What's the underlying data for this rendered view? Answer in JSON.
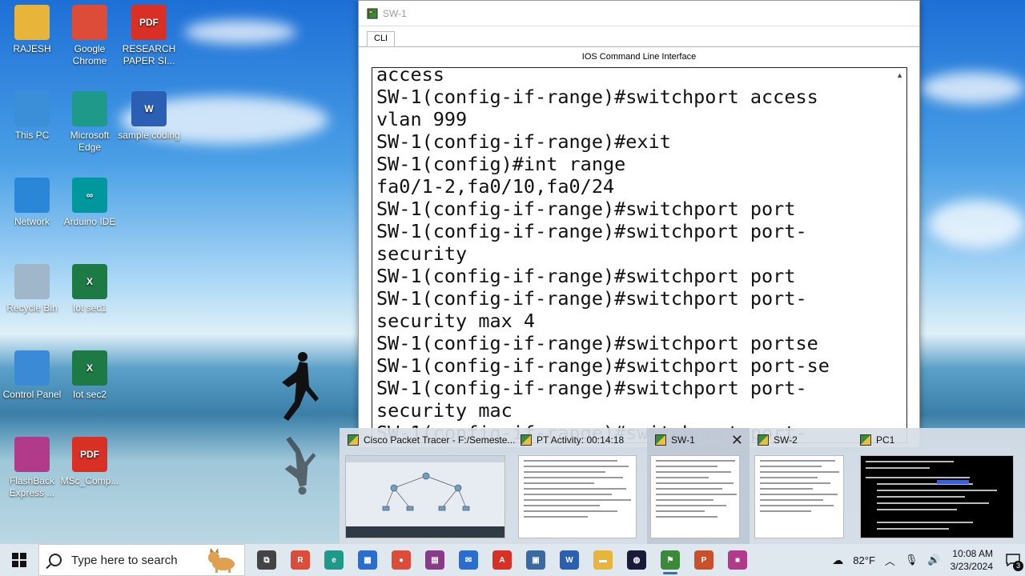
{
  "desktop": {
    "icons": [
      {
        "label": "RAJESH",
        "icon": "user-folder-icon",
        "color": "#e8b53a"
      },
      {
        "label": "Google Chrome",
        "icon": "chrome-icon",
        "color": "#dd4b39"
      },
      {
        "label": "RESEARCH PAPER SI...",
        "icon": "pdf-icon",
        "color": "#d93025",
        "glyph": "PDF"
      },
      {
        "label": "This PC",
        "icon": "computer-icon",
        "color": "#3b8fd9"
      },
      {
        "label": "Microsoft Edge",
        "icon": "edge-icon",
        "color": "#1f9a8a"
      },
      {
        "label": "sample coding",
        "icon": "word-doc-icon",
        "color": "#2b5fb4",
        "glyph": "W"
      },
      {
        "label": "Network",
        "icon": "network-icon",
        "color": "#2a86d6"
      },
      {
        "label": "Arduino IDE",
        "icon": "arduino-icon",
        "color": "#00979d",
        "glyph": "∞"
      },
      {
        "label": "Recycle Bin",
        "icon": "recycle-bin-icon",
        "color": "#9fb7c9"
      },
      {
        "label": "Iot sec1",
        "icon": "excel-icon",
        "color": "#1d7a45",
        "glyph": "X"
      },
      {
        "label": "Control Panel",
        "icon": "control-panel-icon",
        "color": "#3a8ad6"
      },
      {
        "label": "Iot sec2",
        "icon": "excel-icon",
        "color": "#1d7a45",
        "glyph": "X"
      },
      {
        "label": "FlashBack Express ...",
        "icon": "flashback-icon",
        "color": "#b23a8a"
      },
      {
        "label": "MSc_Comp...",
        "icon": "pdf-icon",
        "color": "#d93025",
        "glyph": "PDF"
      }
    ]
  },
  "cli_window": {
    "title": "SW-1",
    "tab": "CLI",
    "heading": "IOS Command Line Interface",
    "terminal_lines": [
      "access",
      "SW-1(config-if-range)#switchport access",
      "vlan 999",
      "SW-1(config-if-range)#exit",
      "SW-1(config)#int range",
      "fa0/1-2,fa0/10,fa0/24",
      "SW-1(config-if-range)#switchport port",
      "SW-1(config-if-range)#switchport port-",
      "security",
      "SW-1(config-if-range)#switchport port",
      "SW-1(config-if-range)#switchport port-",
      "security max 4",
      "SW-1(config-if-range)#switchport portse",
      "SW-1(config-if-range)#switchport port-se",
      "SW-1(config-if-range)#switchport port-",
      "security mac",
      "SW-1(config-if-range)#switchport port-"
    ]
  },
  "thumbnails": [
    {
      "title": "Cisco Packet Tracer - F:/Semeste..."
    },
    {
      "title": "PT Activity: 00:14:18"
    },
    {
      "title": "SW-1",
      "close": "✕"
    },
    {
      "title": "SW-2"
    },
    {
      "title": "PC1"
    }
  ],
  "taskbar": {
    "search_placeholder": "Type here to search",
    "apps": [
      {
        "icon": "task-view-icon",
        "color": "#444",
        "glyph": "⧉"
      },
      {
        "icon": "chrome-profile-icon",
        "color": "#dd4b39",
        "glyph": "R"
      },
      {
        "icon": "edge-icon",
        "color": "#1f9a8a",
        "glyph": "e"
      },
      {
        "icon": "store-icon",
        "color": "#2a6dd1",
        "glyph": "▦"
      },
      {
        "icon": "chrome-icon",
        "color": "#dd4b39",
        "glyph": "●"
      },
      {
        "icon": "winrar-icon",
        "color": "#8a3a8a",
        "glyph": "▤"
      },
      {
        "icon": "mail-icon",
        "color": "#2a6dd1",
        "glyph": "✉"
      },
      {
        "icon": "acrobat-icon",
        "color": "#d93025",
        "glyph": "A"
      },
      {
        "icon": "virtualbox-icon",
        "color": "#3a6aa0",
        "glyph": "▣"
      },
      {
        "icon": "word-icon",
        "color": "#2b5fb4",
        "glyph": "W"
      },
      {
        "icon": "file-explorer-icon",
        "color": "#e8b53a",
        "glyph": "▬"
      },
      {
        "icon": "webex-icon",
        "color": "#1a1a3a",
        "glyph": "◍"
      },
      {
        "icon": "packet-tracer-icon",
        "color": "#3a8a3a",
        "glyph": "⚑",
        "active": true
      },
      {
        "icon": "powerpoint-icon",
        "color": "#c8502a",
        "glyph": "P"
      },
      {
        "icon": "flashback-icon",
        "color": "#b23a8a",
        "glyph": "■"
      }
    ],
    "weather": "82°F",
    "time": "10:08 AM",
    "date": "3/23/2024",
    "notification_count": "3"
  }
}
